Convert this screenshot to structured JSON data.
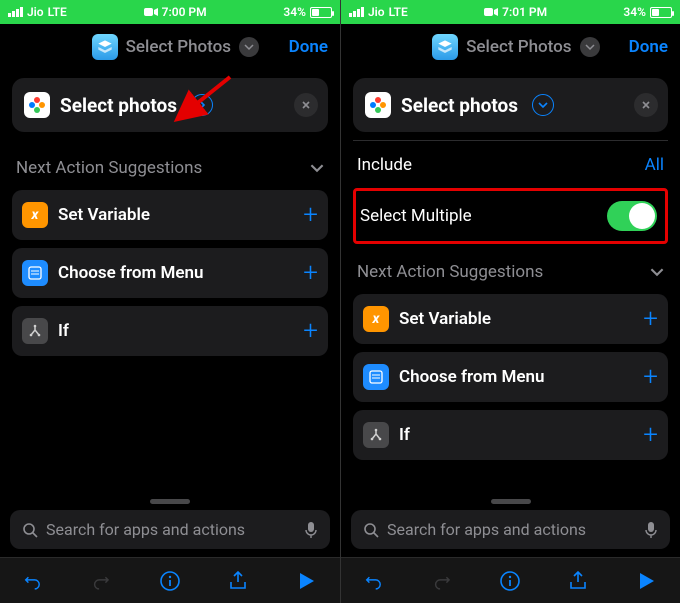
{
  "left": {
    "status": {
      "carrier": "Jio",
      "net": "LTE",
      "time": "7:00 PM",
      "battery": "34%"
    },
    "title": "Select Photos",
    "done": "Done",
    "card": {
      "title": "Select photos"
    },
    "section": "Next Action Suggestions",
    "suggestions": [
      {
        "label": "Set Variable"
      },
      {
        "label": "Choose from Menu"
      },
      {
        "label": "If"
      }
    ],
    "search_placeholder": "Search for apps and actions"
  },
  "right": {
    "status": {
      "carrier": "Jio",
      "net": "LTE",
      "time": "7:01 PM",
      "battery": "34%"
    },
    "title": "Select Photos",
    "done": "Done",
    "card": {
      "title": "Select photos"
    },
    "options": {
      "include_label": "Include",
      "include_value": "All",
      "multi_label": "Select Multiple"
    },
    "section": "Next Action Suggestions",
    "suggestions": [
      {
        "label": "Set Variable"
      },
      {
        "label": "Choose from Menu"
      },
      {
        "label": "If"
      }
    ],
    "search_placeholder": "Search for apps and actions"
  }
}
